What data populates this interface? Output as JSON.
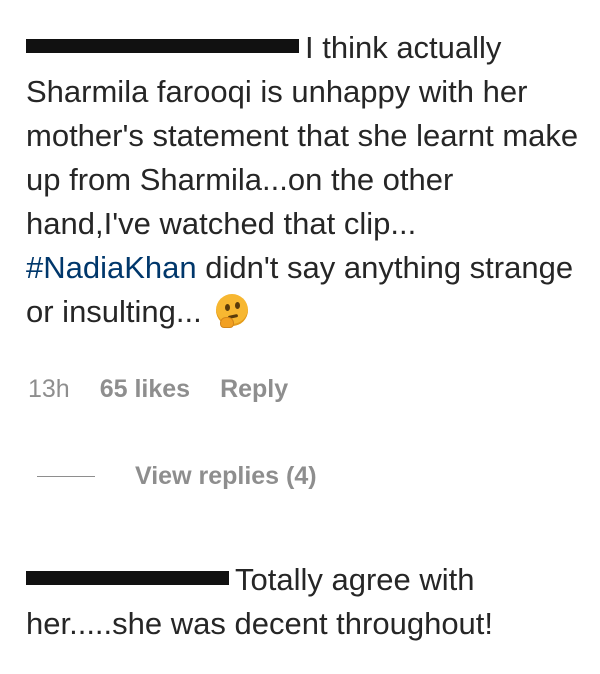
{
  "comments": [
    {
      "username_redacted": true,
      "text_before_hashtag": "I think actually Sharmila farooqi is unhappy with her mother's statement that she learnt make up from Sharmila...on the other hand,I've watched that clip... ",
      "hashtag": "#NadiaKhan",
      "text_after_hashtag": " didn't say anything strange or insulting... ",
      "emoji": "thinking-face",
      "time": "13h",
      "likes": "65 likes",
      "reply_label": "Reply",
      "view_replies_label": "View replies (4)"
    },
    {
      "username_redacted": true,
      "text": "Totally agree with her.....she was decent throughout!"
    }
  ],
  "colors": {
    "text": "#262626",
    "meta": "#8e8e8e",
    "hashtag": "#00376b",
    "redaction": "#111111"
  }
}
